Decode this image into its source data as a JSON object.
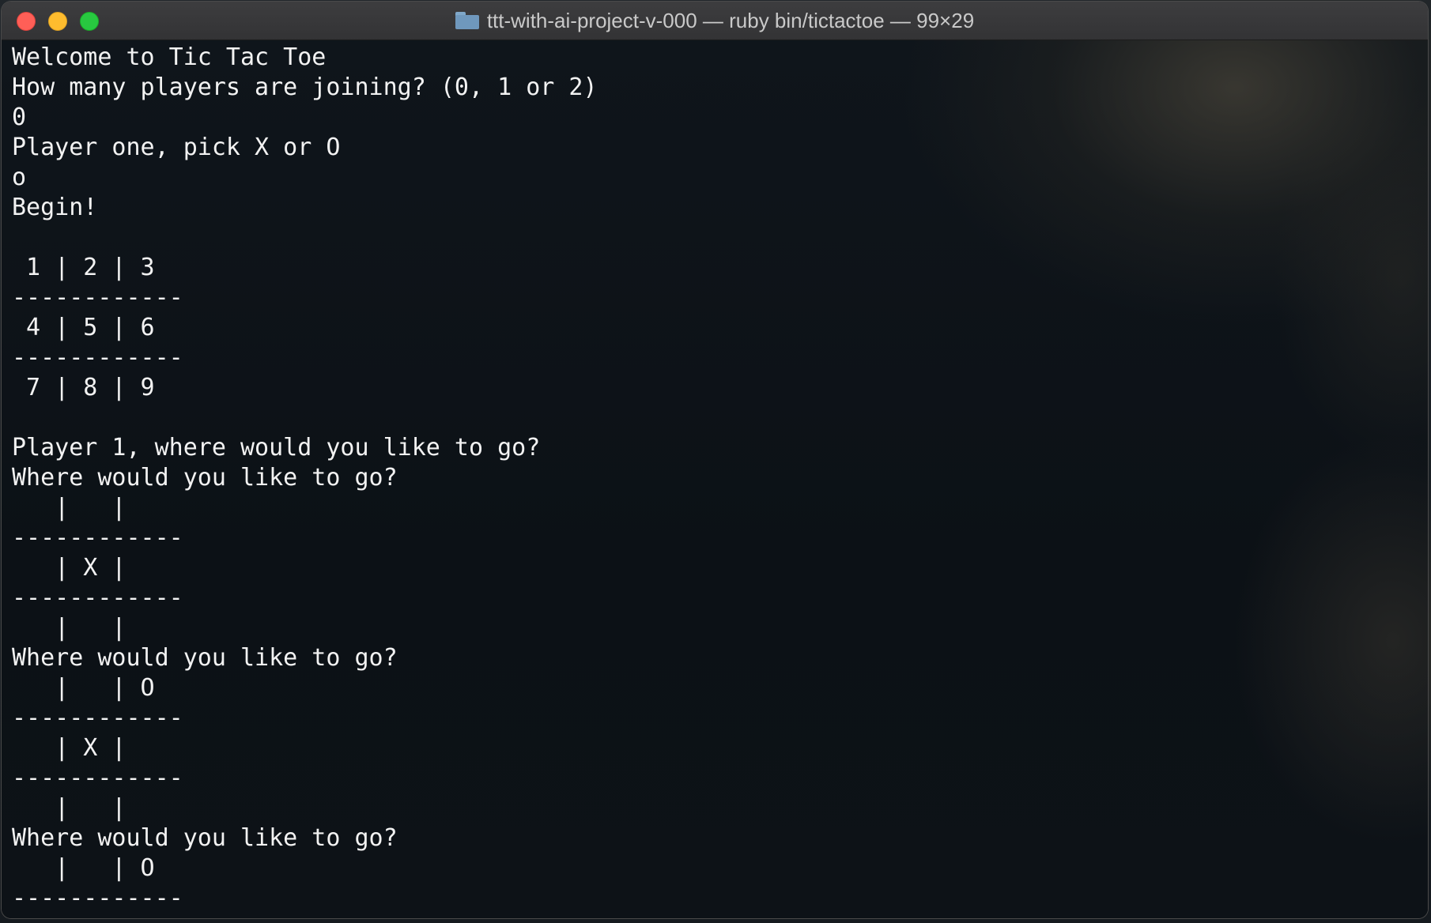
{
  "window": {
    "title": "ttt-with-ai-project-v-000 — ruby bin/tictactoe — 99×29",
    "title_icon": "folder-icon"
  },
  "terminal": {
    "lines": [
      "Welcome to Tic Tac Toe",
      "How many players are joining? (0, 1 or 2)",
      "0",
      "Player one, pick X or O",
      "o",
      "Begin!",
      "",
      " 1 | 2 | 3",
      "------------",
      " 4 | 5 | 6",
      "------------",
      " 7 | 8 | 9",
      "",
      "Player 1, where would you like to go?",
      "Where would you like to go?",
      "   |   |",
      "------------",
      "   | X |",
      "------------",
      "   |   |",
      "Where would you like to go?",
      "   |   | O",
      "------------",
      "   | X |",
      "------------",
      "   |   |",
      "Where would you like to go?",
      "   |   | O",
      "------------"
    ]
  },
  "colors": {
    "close": "#ff5f57",
    "minimize": "#febc2e",
    "maximize": "#28c840",
    "terminal_text": "#f2f2f2"
  }
}
